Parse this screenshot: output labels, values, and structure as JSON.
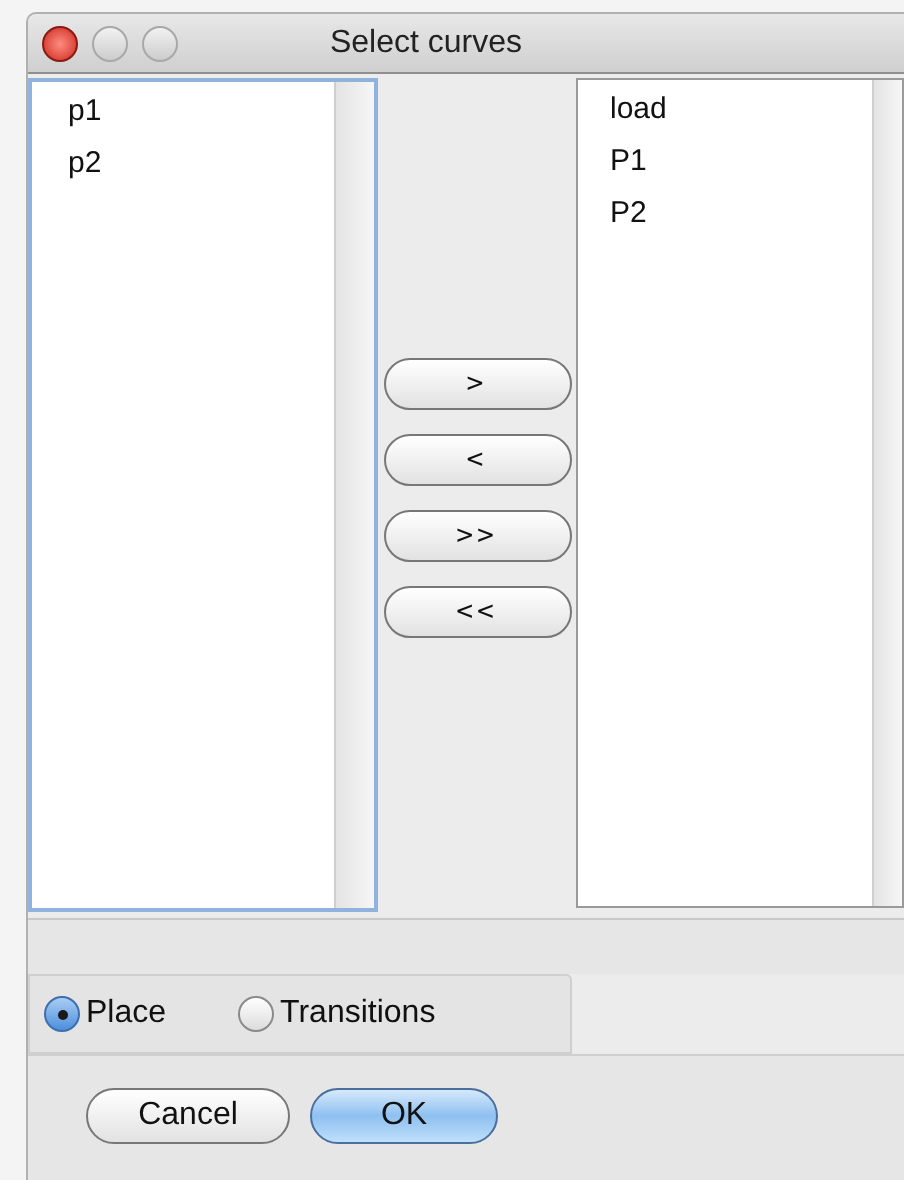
{
  "window": {
    "title": "Select curves"
  },
  "available_list": {
    "items": [
      {
        "label": "p1"
      },
      {
        "label": "p2"
      }
    ]
  },
  "move_buttons": [
    {
      "label": ">"
    },
    {
      "label": "<"
    },
    {
      "label": ">>"
    },
    {
      "label": "<<"
    }
  ],
  "selected_list": {
    "items": [
      {
        "label": "load"
      },
      {
        "label": "P1"
      },
      {
        "label": "P2"
      }
    ]
  },
  "mode_options": [
    {
      "label": "Place",
      "selected": true
    },
    {
      "label": "Transitions",
      "selected": false
    }
  ],
  "buttons": [
    {
      "label": "Cancel",
      "default": false
    },
    {
      "label": "OK",
      "default": true
    }
  ]
}
